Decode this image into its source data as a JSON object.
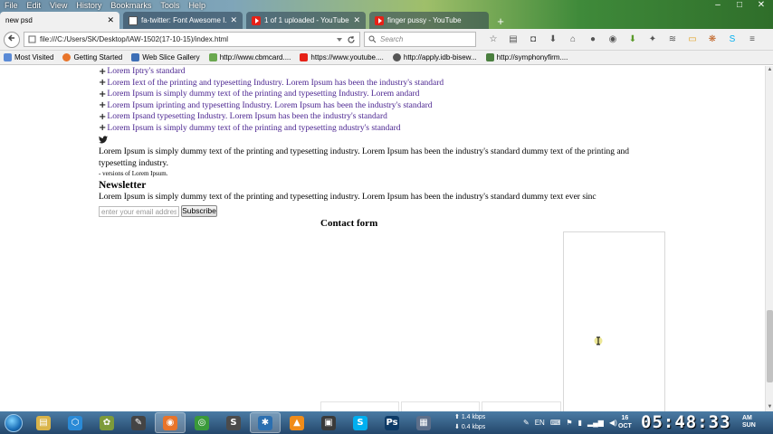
{
  "menu": [
    "File",
    "Edit",
    "View",
    "History",
    "Bookmarks",
    "Tools",
    "Help"
  ],
  "window_controls": {
    "minimize": "–",
    "maximize": "□",
    "close": "✕"
  },
  "tabs": [
    {
      "label": "new psd",
      "active": true
    },
    {
      "label": "fa-twitter: Font Awesome I...",
      "active": false
    },
    {
      "label": "1 of 1 uploaded - YouTube",
      "active": false
    },
    {
      "label": "finger pussy - YouTube",
      "active": false
    }
  ],
  "tab_close": "✕",
  "new_tab": "+",
  "address": {
    "url": "file:///C:/Users/SK/Desktop/IAW-1502(17-10-15)/index.html"
  },
  "search": {
    "placeholder": "Search"
  },
  "bookmarks": [
    {
      "label": "Most Visited",
      "color": "#5a8ad6"
    },
    {
      "label": "Getting Started",
      "color": "#e8742a"
    },
    {
      "label": "Web Slice Gallery",
      "color": "#3d6fb6"
    },
    {
      "label": "http://www.cbmcard....",
      "color": "#6aa84f"
    },
    {
      "label": "https://www.youtube....",
      "color": "#e62117"
    },
    {
      "label": "http://apply.idb-bisew...",
      "color": "#555555"
    },
    {
      "label": "http://symphonyfirm....",
      "color": "#4a7f3f"
    }
  ],
  "content": {
    "links": [
      "Lorem Iptry's standard",
      "Lorem Iext of the printing and typesetting Industry. Lorem Ipsum has been the industry's standard",
      "Lorem Ipsum is simply dummy text of the printing and typesetting Industry. Lorem andard",
      "Lorem Ipsum iprinting and typesetting Industry. Lorem Ipsum has been the industry's standard",
      "Lorem Ipsand typesetting Industry. Lorem Ipsum has been the industry's standard",
      "Lorem Ipsum is simply dummy text of the printing and typesetting ndustry's standard"
    ],
    "link_icon": "+",
    "paragraph": "Lorem Ipsum is simply dummy text of the printing and typesetting industry. Lorem Ipsum has been the industry's standard dummy text of the printing and typesetting industry.",
    "small_text": "- versions of Lorem Ipsum.",
    "newsletter_title": "Newsletter",
    "newsletter_text": "Lorem Ipsum is simply dummy text of the printing and typesetting industry. Lorem Ipsum has been the industry's standard dummy text ever sinc",
    "email_placeholder": "enter your email address",
    "subscribe_label": "Subscribe",
    "contact_title": "Contact form"
  },
  "taskbar": {
    "apps": [
      {
        "name": "explorer",
        "glyph": "▤",
        "color": "#d9b44a"
      },
      {
        "name": "share",
        "glyph": "⬡",
        "color": "#2a8ad6"
      },
      {
        "name": "gimp",
        "glyph": "✿",
        "color": "#7d9b3a"
      },
      {
        "name": "pen",
        "glyph": "✎",
        "color": "#444444"
      },
      {
        "name": "firefox",
        "glyph": "◉",
        "color": "#e8742a",
        "active": true
      },
      {
        "name": "chrome",
        "glyph": "◎",
        "color": "#3a9a3a"
      },
      {
        "name": "sublime",
        "glyph": "S",
        "color": "#4b4b4b"
      },
      {
        "name": "tool",
        "glyph": "✱",
        "color": "#2b6fb0",
        "active": true
      },
      {
        "name": "vlc",
        "glyph": "▲",
        "color": "#f08c1a"
      },
      {
        "name": "app",
        "glyph": "▣",
        "color": "#3a3a3a"
      },
      {
        "name": "skype",
        "glyph": "S",
        "color": "#00aff0"
      },
      {
        "name": "photoshop",
        "glyph": "Ps",
        "color": "#0d3a66"
      },
      {
        "name": "archive",
        "glyph": "▦",
        "color": "#5d6f8a"
      }
    ],
    "net_up": "1.4 kbps",
    "net_down": "0.4 kbps",
    "lang": "EN",
    "date_day": "16",
    "date_month": "OCT",
    "time": "05:48:33",
    "ampm": "AM",
    "weekday": "SUN"
  }
}
